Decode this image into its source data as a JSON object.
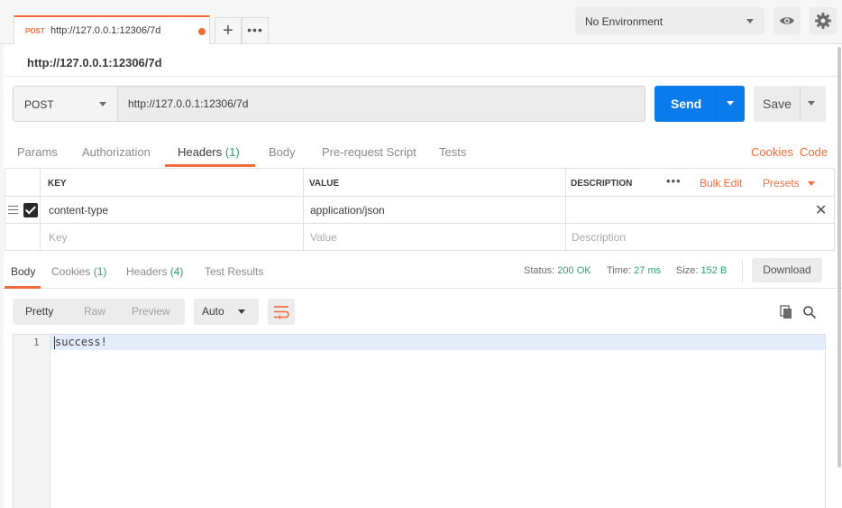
{
  "tab": {
    "method": "POST",
    "url": "http://127.0.0.1:12306/7d",
    "add": "+",
    "more": "•••"
  },
  "environment": {
    "selected": "No Environment"
  },
  "request": {
    "title": "http://127.0.0.1:12306/7d",
    "method": "POST",
    "url": "http://127.0.0.1:12306/7d",
    "send_label": "Send",
    "save_label": "Save"
  },
  "request_tabs": {
    "params": "Params",
    "authorization": "Authorization",
    "headers": "Headers",
    "headers_count": "(1)",
    "body": "Body",
    "prerequest": "Pre-request Script",
    "tests": "Tests",
    "cookies": "Cookies",
    "code": "Code"
  },
  "headers_table": {
    "columns": {
      "key": "KEY",
      "value": "VALUE",
      "description": "DESCRIPTION"
    },
    "more": "•••",
    "bulk_edit": "Bulk Edit",
    "presets": "Presets",
    "rows": [
      {
        "key": "content-type",
        "value": "application/json",
        "description": ""
      }
    ],
    "placeholders": {
      "key": "Key",
      "value": "Value",
      "description": "Description"
    }
  },
  "response": {
    "tabs": {
      "body": "Body",
      "cookies": "Cookies",
      "cookies_count": "(1)",
      "headers": "Headers",
      "headers_count": "(4)",
      "test_results": "Test Results"
    },
    "status_label": "Status:",
    "status_value": "200 OK",
    "time_label": "Time:",
    "time_value": "27 ms",
    "size_label": "Size:",
    "size_value": "152 B",
    "download": "Download",
    "views": {
      "pretty": "Pretty",
      "raw": "Raw",
      "preview": "Preview"
    },
    "format": "Auto",
    "lines": [
      {
        "number": "1",
        "text": "success!"
      }
    ]
  },
  "colors": {
    "accent": "#f26b3a",
    "send": "#097bed",
    "success": "#2d9f6f"
  }
}
